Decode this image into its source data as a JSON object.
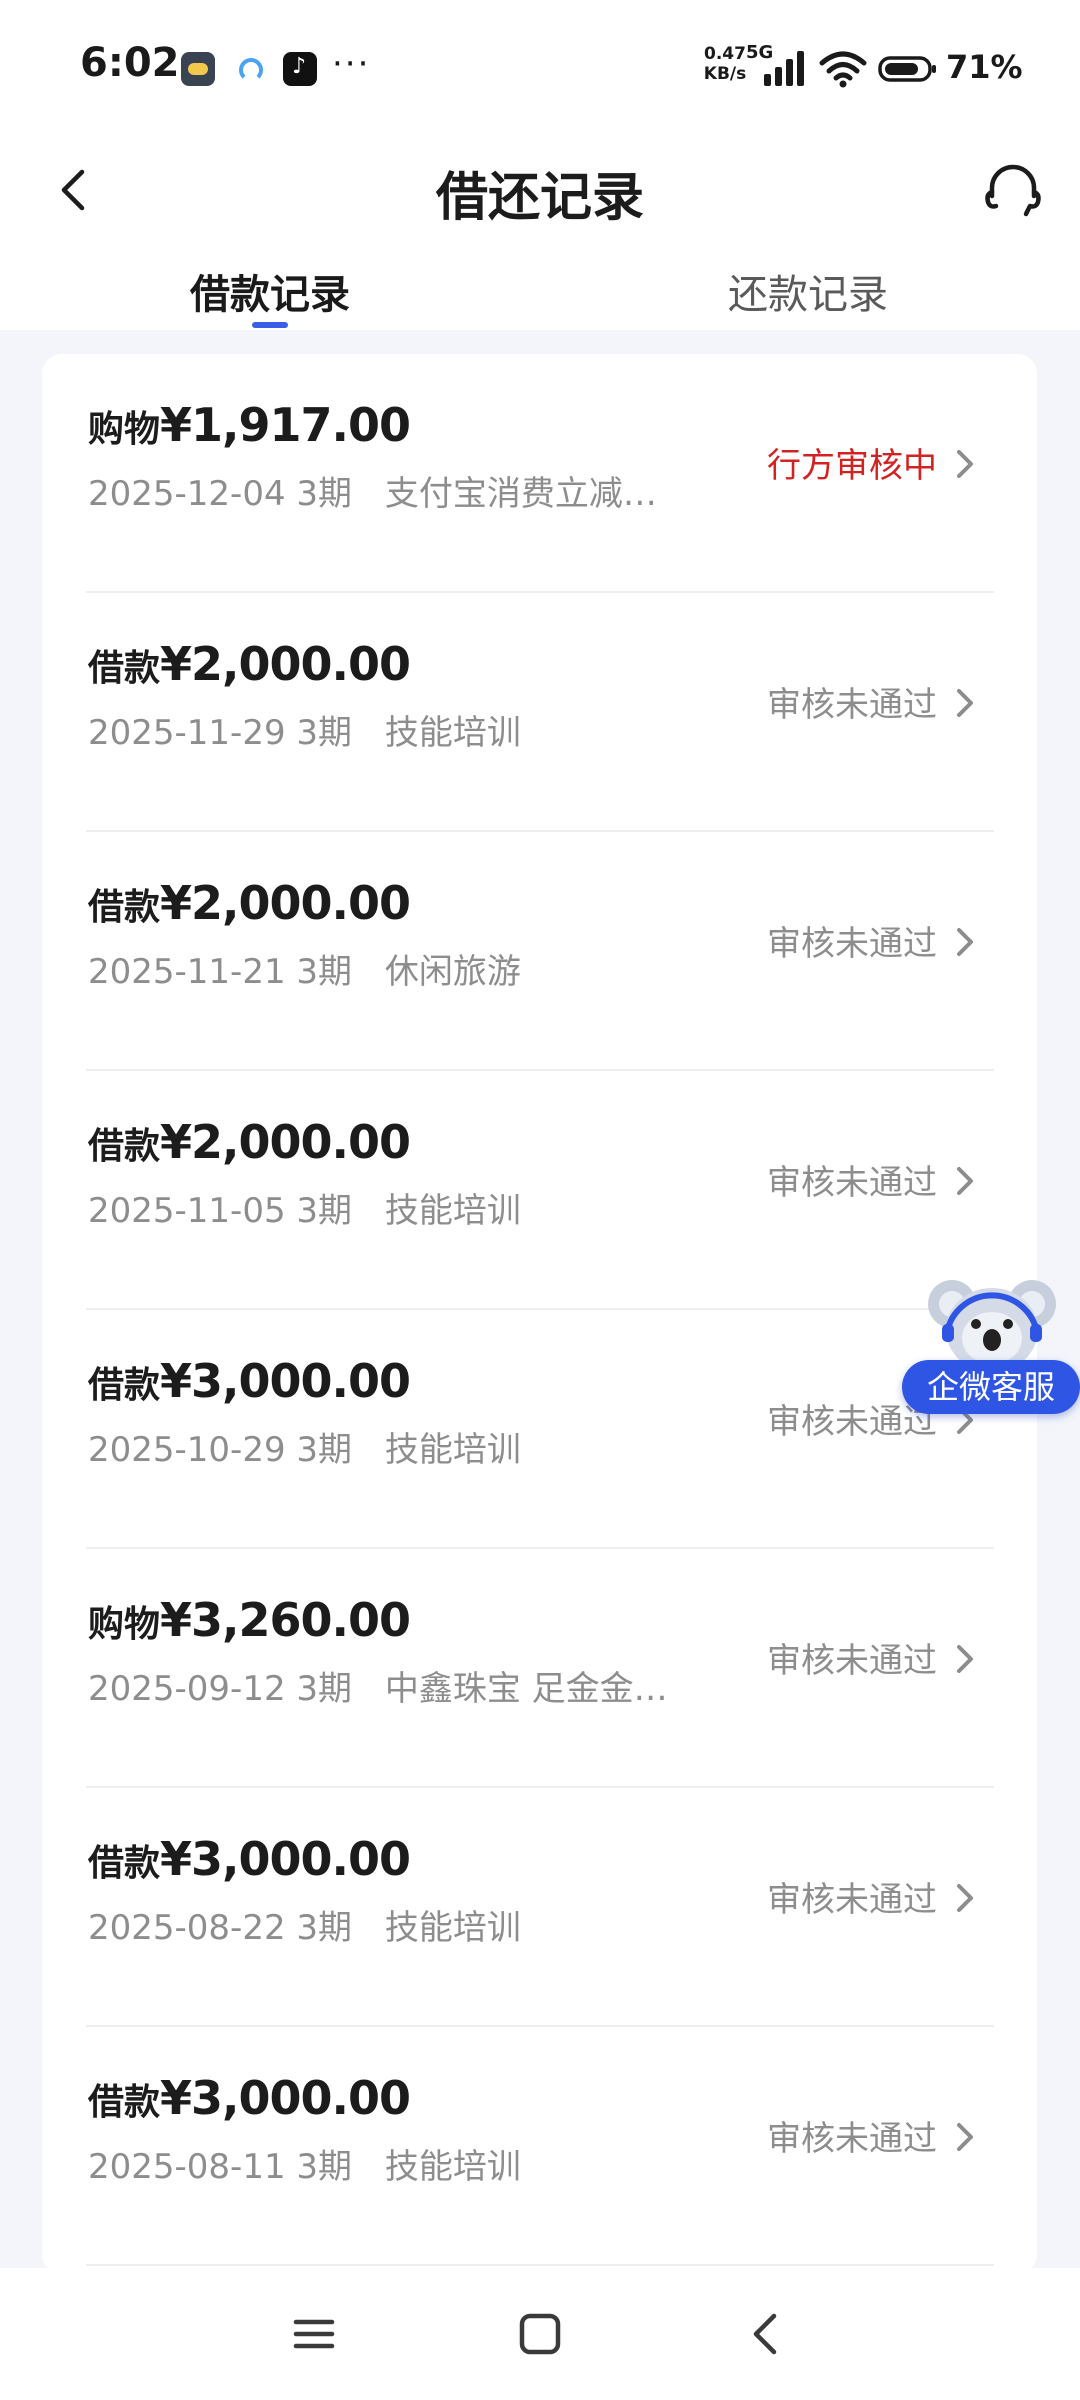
{
  "status_bar": {
    "time": "6:02",
    "net_speed_value": "0.47",
    "net_speed_unit": "KB/s",
    "network_type": "5G",
    "battery": "71%"
  },
  "header": {
    "title": "借还记录",
    "tabs": [
      {
        "label": "借款记录",
        "active": true
      },
      {
        "label": "还款记录",
        "active": false
      }
    ]
  },
  "records": [
    {
      "type": "购物",
      "amount": "¥1,917.00",
      "date": "2025-12-04",
      "term": "3期",
      "purpose": "支付宝消费立减金 …",
      "status": "行方审核中",
      "status_color": "#d22323"
    },
    {
      "type": "借款",
      "amount": "¥2,000.00",
      "date": "2025-11-29",
      "term": "3期",
      "purpose": "技能培训",
      "status": "审核未通过",
      "status_color": "#8d8d8d"
    },
    {
      "type": "借款",
      "amount": "¥2,000.00",
      "date": "2025-11-21",
      "term": "3期",
      "purpose": "休闲旅游",
      "status": "审核未通过",
      "status_color": "#8d8d8d"
    },
    {
      "type": "借款",
      "amount": "¥2,000.00",
      "date": "2025-11-05",
      "term": "3期",
      "purpose": "技能培训",
      "status": "审核未通过",
      "status_color": "#8d8d8d"
    },
    {
      "type": "借款",
      "amount": "¥3,000.00",
      "date": "2025-10-29",
      "term": "3期",
      "purpose": "技能培训",
      "status": "审核未通过",
      "status_color": "#8d8d8d"
    },
    {
      "type": "购物",
      "amount": "¥3,260.00",
      "date": "2025-09-12",
      "term": "3期",
      "purpose": "中鑫珠宝 足金金瓜…",
      "status": "审核未通过",
      "status_color": "#8d8d8d"
    },
    {
      "type": "借款",
      "amount": "¥3,000.00",
      "date": "2025-08-22",
      "term": "3期",
      "purpose": "技能培训",
      "status": "审核未通过",
      "status_color": "#8d8d8d"
    },
    {
      "type": "借款",
      "amount": "¥3,000.00",
      "date": "2025-08-11",
      "term": "3期",
      "purpose": "技能培训",
      "status": "审核未通过",
      "status_color": "#8d8d8d"
    }
  ],
  "floating_widget": {
    "label": "企微客服",
    "icon": "koala-support-icon"
  },
  "icons": {
    "back": "chevron-left-icon",
    "support": "headset-icon",
    "row_arrow": "chevron-right-icon",
    "nav": [
      "menu-icon",
      "home-square-icon",
      "back-triangle-icon"
    ]
  },
  "colors": {
    "accent": "#3b5ee8",
    "pending_status": "#d22323",
    "muted_text": "#8d8d8d",
    "widget_bg": "#2f55e4",
    "page_bg": "#f3f5fb"
  }
}
